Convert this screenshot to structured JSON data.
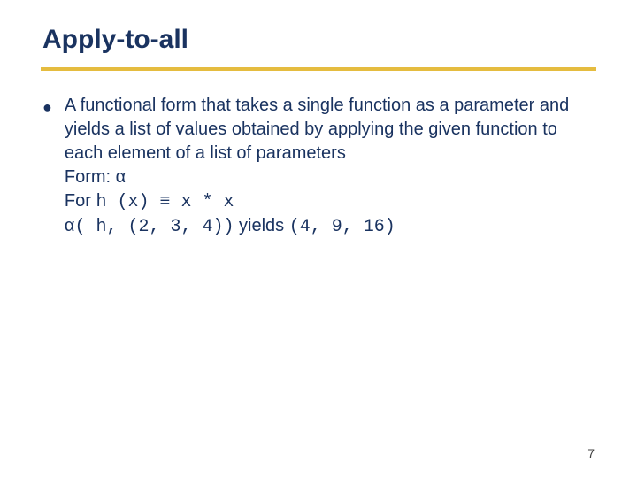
{
  "slide": {
    "title": "Apply-to-all",
    "bullet_glyph": "●",
    "definition": "A functional form that takes a single function as a parameter and yields a list of values obtained by applying the given function to each element of a list of parameters",
    "form_label": "Form: ",
    "form_symbol": "α",
    "for_label": "For ",
    "for_code": "h (x) ≡ x * x",
    "apply_symbol": "α",
    "apply_code_open": "( h, (2, 3, 4))",
    "yields_label": "  yields ",
    "yields_result": "(4, 9, 16)",
    "page_number": "7"
  }
}
